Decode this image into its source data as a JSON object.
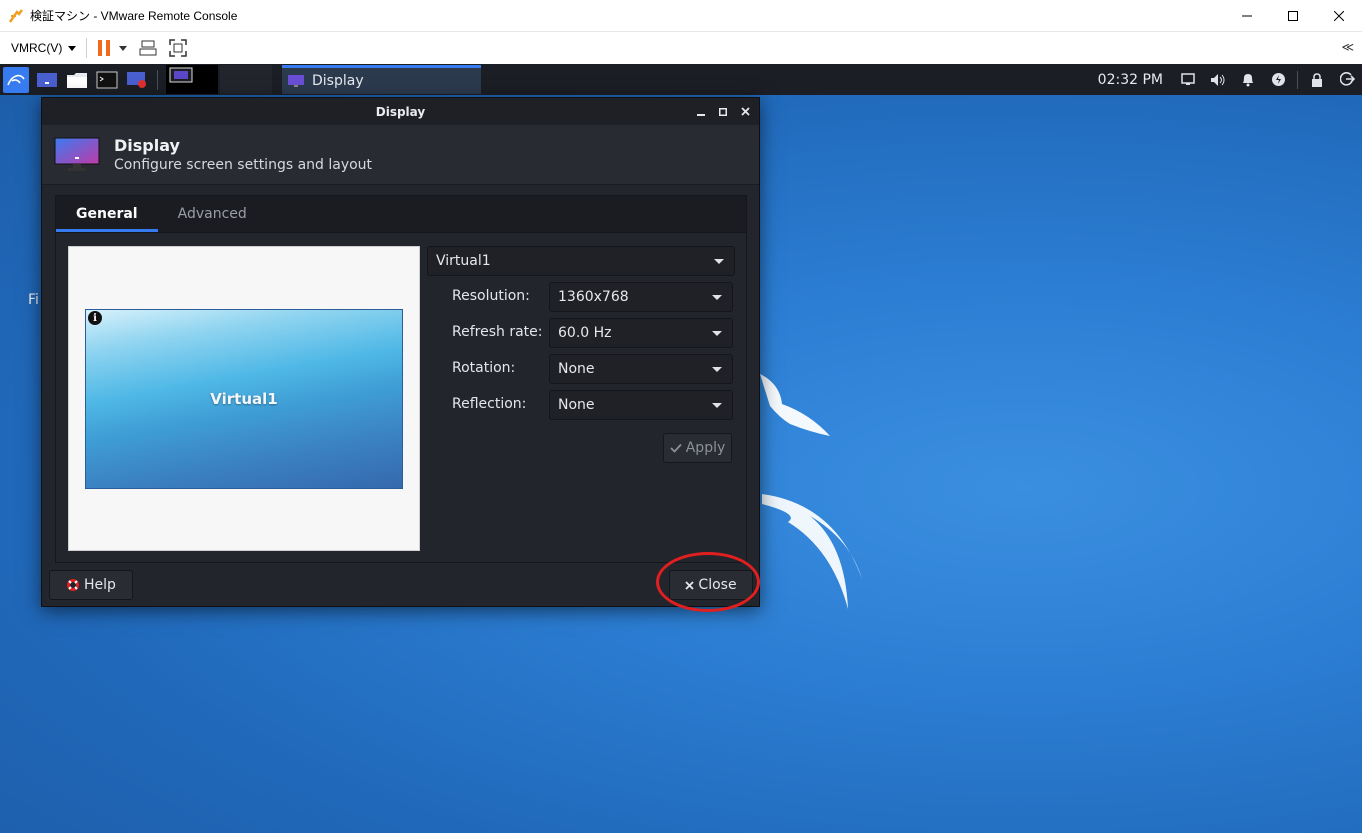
{
  "host": {
    "window_title": "検証マシン - VMware Remote Console",
    "menu_label": "VMRC(V)",
    "collapse_glyph": "≪"
  },
  "panel": {
    "task_label": "Display",
    "clock": "02:32 PM"
  },
  "desktop": {
    "partial_text": "Fi"
  },
  "dialog": {
    "title": "Display",
    "header_title": "Display",
    "header_subtitle": "Configure screen settings and layout",
    "tabs": [
      {
        "label": "General",
        "active": true
      },
      {
        "label": "Advanced",
        "active": false
      }
    ],
    "monitor_name": "Virtual1",
    "info_glyph": "i",
    "output_select": "Virtual1",
    "fields": [
      {
        "label": "Resolution:",
        "value": "1360x768"
      },
      {
        "label": "Refresh rate:",
        "value": "60.0 Hz"
      },
      {
        "label": "Rotation:",
        "value": "None"
      },
      {
        "label": "Reflection:",
        "value": "None"
      }
    ],
    "apply_label": "Apply",
    "help_label": "Help",
    "close_label": "Close"
  },
  "colors": {
    "accent": "#367bf0",
    "panel_bg": "#1b1e24",
    "dialog_bg": "#23252c",
    "highlight": "#e02020",
    "pause_orange": "#f26b1d"
  }
}
